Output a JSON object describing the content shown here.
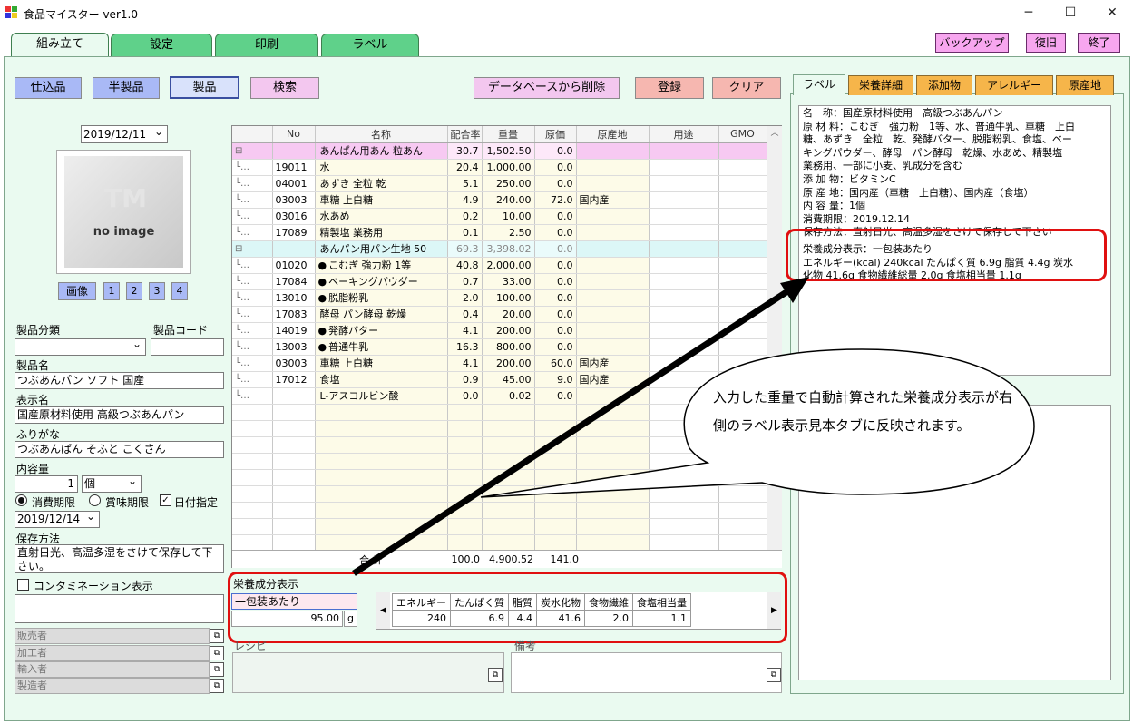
{
  "window": {
    "title": "食品マイスター ver1.0",
    "min": "─",
    "max": "☐",
    "close": "✕"
  },
  "tabs": [
    "組み立て",
    "設定",
    "印刷",
    "ラベル"
  ],
  "top_buttons": {
    "backup": "バックアップ",
    "restore": "復旧",
    "exit": "終了"
  },
  "toolbar": {
    "shikomi": "仕込品",
    "hanseihin": "半製品",
    "seihin": "製品",
    "search": "検索",
    "delete_db": "データベースから削除",
    "register": "登録",
    "clear": "クリア"
  },
  "image": {
    "date": "2019/12/11",
    "placeholder": "no image",
    "logo": "TM",
    "btn": "画像",
    "pages": [
      "1",
      "2",
      "3",
      "4"
    ]
  },
  "form": {
    "category_label": "製品分類",
    "code_label": "製品コード",
    "category_value": "",
    "code_value": "",
    "name_label": "製品名",
    "name_value": "つぶあんパン ソフト 国産",
    "display_label": "表示名",
    "display_value": "国産原材料使用 高級つぶあんパン",
    "furigana_label": "ふりがな",
    "furigana_value": "つぶあんぱん そふと こくさん",
    "content_label": "内容量",
    "content_qty": "1",
    "content_unit": "個",
    "expiry_radio1": "消費期限",
    "expiry_radio2": "賞味期限",
    "date_check": "日付指定",
    "expiry_date": "2019/12/14",
    "storage_label": "保存方法",
    "storage_value": "直射日光、高温多湿をさけて保存して下さい。",
    "contam_label": "コンタミネーション表示",
    "seller": "販売者",
    "processor": "加工者",
    "importer": "輸入者",
    "maker": "製造者"
  },
  "grid": {
    "headers": [
      "No",
      "名称",
      "配合率",
      "重量",
      "原価",
      "原産地",
      "用途",
      "GMO"
    ],
    "rows": [
      {
        "t": "group1",
        "tree": "⊟",
        "no": "",
        "mark": "",
        "name": "あんぱん用あん 粒あん",
        "ratio": "30.7",
        "weight": "1,502.50",
        "cost": "0.0",
        "origin": ""
      },
      {
        "t": "item",
        "tree": "└…",
        "no": "19011",
        "mark": "",
        "name": "水",
        "ratio": "20.4",
        "weight": "1,000.00",
        "cost": "0.0",
        "origin": ""
      },
      {
        "t": "item",
        "tree": "└…",
        "no": "04001",
        "mark": "",
        "name": "あずき 全粒 乾",
        "ratio": "5.1",
        "weight": "250.00",
        "cost": "0.0",
        "origin": ""
      },
      {
        "t": "item",
        "tree": "└…",
        "no": "03003",
        "mark": "",
        "name": "車糖 上白糖",
        "ratio": "4.9",
        "weight": "240.00",
        "cost": "72.0",
        "origin": "国内産"
      },
      {
        "t": "item",
        "tree": "└…",
        "no": "03016",
        "mark": "",
        "name": "水あめ",
        "ratio": "0.2",
        "weight": "10.00",
        "cost": "0.0",
        "origin": ""
      },
      {
        "t": "item",
        "tree": "└…",
        "no": "17089",
        "mark": "",
        "name": "精製塩 業務用",
        "ratio": "0.1",
        "weight": "2.50",
        "cost": "0.0",
        "origin": ""
      },
      {
        "t": "group2",
        "tree": "⊟",
        "no": "",
        "mark": "",
        "name": "あんパン用パン生地 50",
        "ratio": "69.3",
        "weight": "3,398.02",
        "cost": "0.0",
        "origin": ""
      },
      {
        "t": "item",
        "tree": "└…",
        "no": "01020",
        "mark": "●",
        "name": "こむぎ 強力粉 1等",
        "ratio": "40.8",
        "weight": "2,000.00",
        "cost": "0.0",
        "origin": ""
      },
      {
        "t": "item",
        "tree": "└…",
        "no": "17084",
        "mark": "●",
        "name": "ベーキングパウダー",
        "ratio": "0.7",
        "weight": "33.00",
        "cost": "0.0",
        "origin": ""
      },
      {
        "t": "item",
        "tree": "└…",
        "no": "13010",
        "mark": "●",
        "name": "脱脂粉乳",
        "ratio": "2.0",
        "weight": "100.00",
        "cost": "0.0",
        "origin": ""
      },
      {
        "t": "item",
        "tree": "└…",
        "no": "17083",
        "mark": "",
        "name": "酵母 パン酵母 乾燥",
        "ratio": "0.4",
        "weight": "20.00",
        "cost": "0.0",
        "origin": ""
      },
      {
        "t": "item",
        "tree": "└…",
        "no": "14019",
        "mark": "●",
        "name": "発酵バター",
        "ratio": "4.1",
        "weight": "200.00",
        "cost": "0.0",
        "origin": ""
      },
      {
        "t": "item",
        "tree": "└…",
        "no": "13003",
        "mark": "●",
        "name": "普通牛乳",
        "ratio": "16.3",
        "weight": "800.00",
        "cost": "0.0",
        "origin": ""
      },
      {
        "t": "item",
        "tree": "└…",
        "no": "03003",
        "mark": "",
        "name": "車糖 上白糖",
        "ratio": "4.1",
        "weight": "200.00",
        "cost": "60.0",
        "origin": "国内産"
      },
      {
        "t": "item",
        "tree": "└…",
        "no": "17012",
        "mark": "",
        "name": "食塩",
        "ratio": "0.9",
        "weight": "45.00",
        "cost": "9.0",
        "origin": "国内産"
      },
      {
        "t": "item",
        "tree": "└…",
        "no": "",
        "mark": "",
        "name": "L-アスコルビン酸",
        "ratio": "0.0",
        "weight": "0.02",
        "cost": "0.0",
        "origin": ""
      }
    ],
    "total_label": "合 計",
    "total_ratio": "100.0",
    "total_weight": "4,900.52",
    "total_cost": "141.0"
  },
  "nutrition": {
    "title": "栄養成分表示",
    "per_label": "一包装あたり",
    "amount": "95.00",
    "unit": "g",
    "headers": [
      "エネルギー",
      "たんぱく質",
      "脂質",
      "炭水化物",
      "食物繊維",
      "食塩相当量"
    ],
    "values": [
      "240",
      "6.9",
      "4.4",
      "41.6",
      "2.0",
      "1.1"
    ]
  },
  "recipe_label": "レシピ",
  "memo_label": "備考",
  "right_tabs": [
    "ラベル",
    "栄養詳細",
    "添加物",
    "アレルギー",
    "原産地"
  ],
  "label_lines": [
    "名　称：国産原材料使用　高級つぶあんパン",
    "原 材 料：こむぎ　強力粉　1等、水、普通牛乳、車糖　上白",
    "糖、あずき　全粒　乾、発酵バター、脱脂粉乳、食塩、ベー",
    "キングパウダー、酵母　パン酵母　乾燥、水あめ、精製塩",
    "業務用、一部に小麦、乳成分を含む",
    "添 加 物：ビタミンC",
    "原 産 地：国内産（車糖　上白糖）、国内産（食塩）",
    "内 容 量：1個",
    "消費期限：2019.12.14",
    "保存方法：直射日光、高温多湿をさけて保存して下さい"
  ],
  "label_nutri_lines": [
    "栄養成分表示：一包装あたり",
    "エネルギー(kcal) 240kcal たんぱく質 6.9g 脂質 4.4g 炭水",
    "化物 41.6g 食物繊維総量 2.0g 食塩相当量 1.1g"
  ],
  "callout": "入力した重量で自動計算された栄養成分表示が右側のラベル表示見本タブに反映されます。",
  "colors": {
    "green_tab": "#5fd18a",
    "panel": "#eafaf0",
    "pink": "#f7a6ef",
    "orange_tab": "#f6b54a",
    "highlight": "#e01010"
  }
}
